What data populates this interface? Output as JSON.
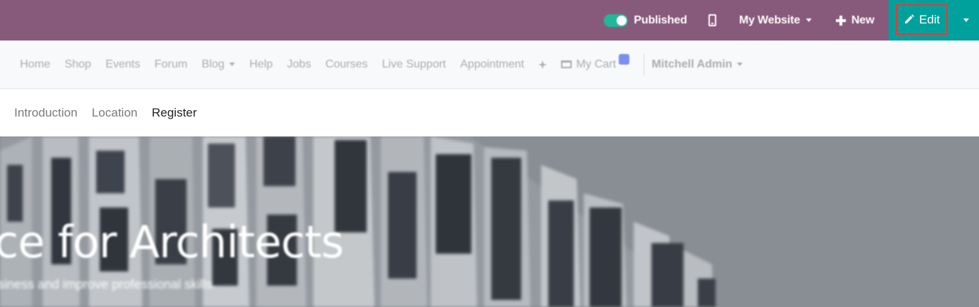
{
  "admin_bar": {
    "published_label": "Published",
    "website_label": "My Website",
    "new_label": "New",
    "edit_label": "Edit",
    "colors": {
      "bar": "#875a7b",
      "edit_zone": "#00a09d",
      "toggle_on": "#21b799",
      "highlight": "#e53935"
    }
  },
  "site_nav": {
    "items": [
      "Home",
      "Shop",
      "Events",
      "Forum",
      "Blog",
      "Help",
      "Jobs",
      "Courses",
      "Live Support",
      "Appointment"
    ],
    "cart_label": "My Cart",
    "user_label": "Mitchell Admin"
  },
  "event_nav": {
    "tabs": [
      "Introduction",
      "Location",
      "Register"
    ],
    "active_tab": "Register"
  },
  "hero": {
    "title": "ce for Architects",
    "subtitle": "siness and improve professional skills."
  }
}
